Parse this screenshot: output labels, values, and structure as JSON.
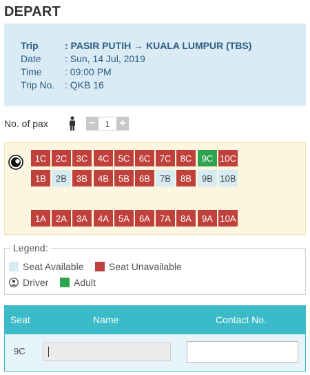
{
  "page": {
    "title": "DEPART"
  },
  "trip": {
    "rows": [
      {
        "label": "Trip",
        "value": ": PASIR PUTIH → KUALA LUMPUR (TBS)"
      },
      {
        "label": "Date",
        "value": ": Sun, 14 Jul, 2019"
      },
      {
        "label": "Time",
        "value": ": 09:00 PM"
      },
      {
        "label": "Trip No.",
        "value": ": QKB 16"
      }
    ]
  },
  "pax": {
    "label": "No. of pax",
    "count": "1",
    "minus": "−",
    "plus": "+"
  },
  "seats": {
    "row_c": [
      {
        "id": "1C",
        "status": "unavailable"
      },
      {
        "id": "2C",
        "status": "unavailable"
      },
      {
        "id": "3C",
        "status": "unavailable"
      },
      {
        "id": "4C",
        "status": "unavailable"
      },
      {
        "id": "5C",
        "status": "unavailable"
      },
      {
        "id": "6C",
        "status": "unavailable"
      },
      {
        "id": "7C",
        "status": "unavailable"
      },
      {
        "id": "8C",
        "status": "unavailable"
      },
      {
        "id": "9C",
        "status": "adult"
      },
      {
        "id": "10C",
        "status": "unavailable"
      }
    ],
    "row_b": [
      {
        "id": "1B",
        "status": "unavailable"
      },
      {
        "id": "2B",
        "status": "available"
      },
      {
        "id": "3B",
        "status": "unavailable"
      },
      {
        "id": "4B",
        "status": "unavailable"
      },
      {
        "id": "5B",
        "status": "unavailable"
      },
      {
        "id": "6B",
        "status": "unavailable"
      },
      {
        "id": "7B",
        "status": "available"
      },
      {
        "id": "8B",
        "status": "unavailable"
      },
      {
        "id": "9B",
        "status": "available"
      },
      {
        "id": "10B",
        "status": "available"
      }
    ],
    "row_a": [
      {
        "id": "1A",
        "status": "unavailable"
      },
      {
        "id": "2A",
        "status": "unavailable"
      },
      {
        "id": "3A",
        "status": "unavailable"
      },
      {
        "id": "4A",
        "status": "unavailable"
      },
      {
        "id": "5A",
        "status": "unavailable"
      },
      {
        "id": "6A",
        "status": "unavailable"
      },
      {
        "id": "7A",
        "status": "unavailable"
      },
      {
        "id": "8A",
        "status": "unavailable"
      },
      {
        "id": "9A",
        "status": "unavailable"
      },
      {
        "id": "10A",
        "status": "unavailable"
      }
    ]
  },
  "legend": {
    "title": "Legend:",
    "available": "Seat Available",
    "unavailable": "Seat Unavailable",
    "driver": "Driver",
    "adult": "Adult"
  },
  "colors": {
    "available": "#d7ebf3",
    "unavailable": "#c0403c",
    "adult": "#2ea44f",
    "header": "#3bbac8"
  },
  "table": {
    "headers": {
      "seat": "Seat",
      "name": "Name",
      "contact": "Contact No."
    },
    "rows": [
      {
        "seat": "9C",
        "name": "",
        "contact": ""
      }
    ]
  }
}
